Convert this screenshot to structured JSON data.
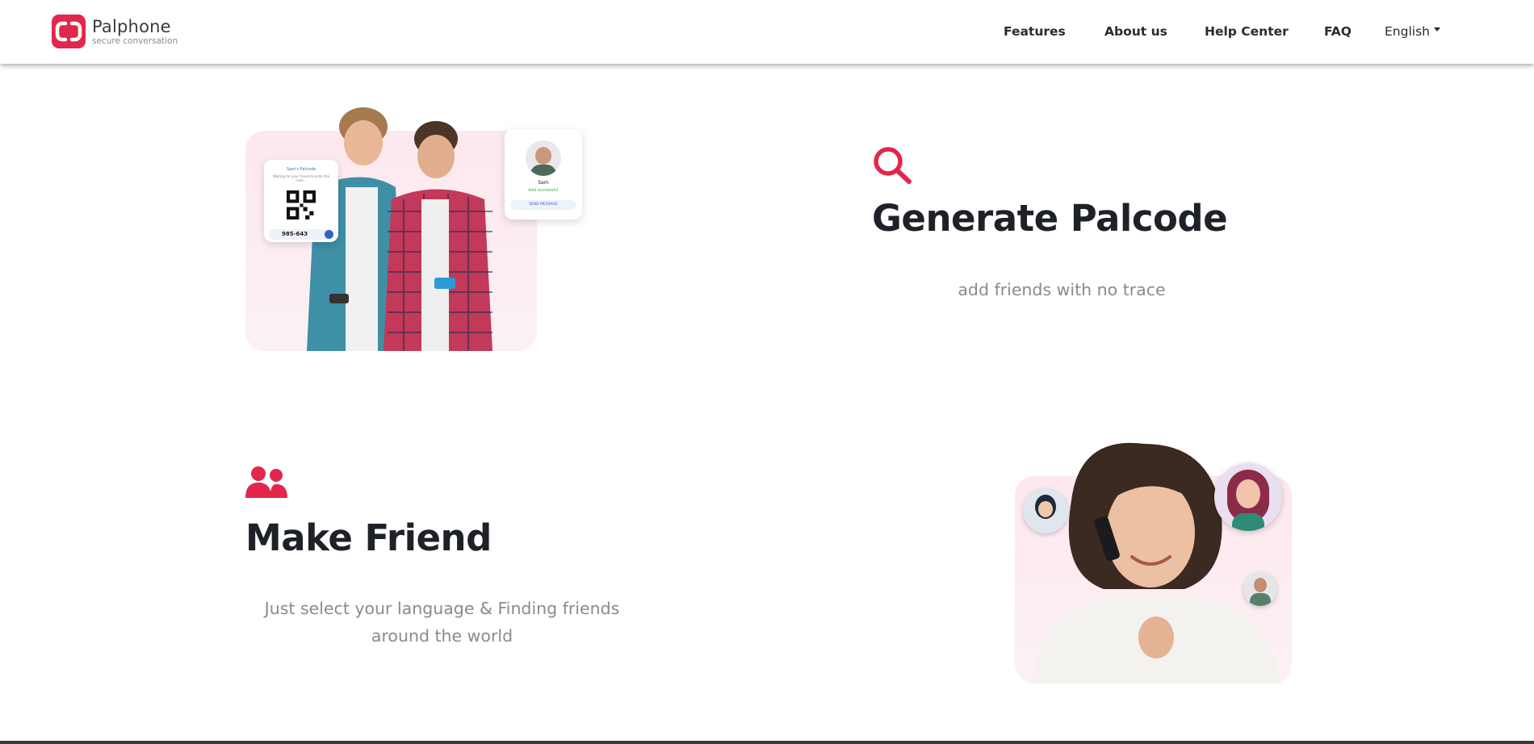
{
  "brand": {
    "name": "Palphone",
    "tagline": "secure conversation",
    "accent": "#e3264b"
  },
  "nav": {
    "items": [
      {
        "label": "Features"
      },
      {
        "label": "About us"
      },
      {
        "label": "Help Center"
      },
      {
        "label": "FAQ"
      }
    ],
    "language": "English"
  },
  "section_palcode": {
    "icon": "search-icon",
    "title": "Generate Palcode",
    "subtitle": "add friends with no trace",
    "card_qr": {
      "title": "Sam's Palcode",
      "caption": "Waiting for your friend to enter the code...",
      "code": "985-643"
    },
    "card_contact": {
      "name": "Sam",
      "status": "Add successful",
      "button": "SEND MESSAGE"
    }
  },
  "section_friend": {
    "icon": "people-icon",
    "title": "Make Friend",
    "subtitle_line1": "Just select your language & Finding friends",
    "subtitle_line2": "around the world"
  }
}
